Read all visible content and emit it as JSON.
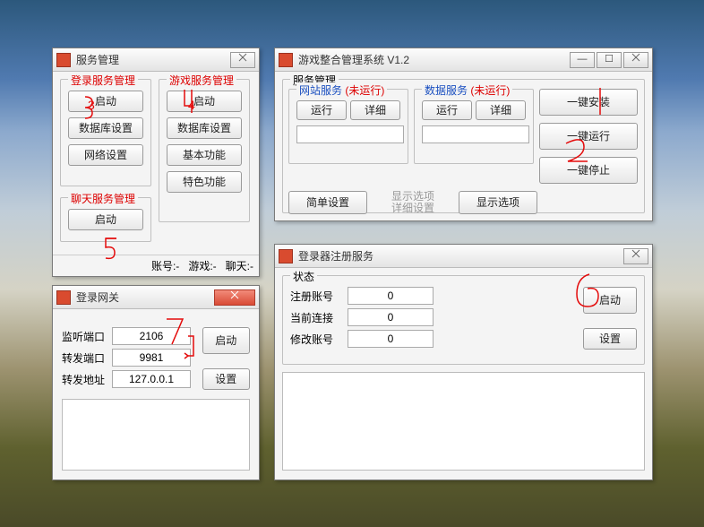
{
  "w1": {
    "title": "服务管理",
    "login_group": "登录服务管理",
    "login_start": "启动",
    "login_db": "数据库设置",
    "login_net": "网络设置",
    "game_group": "游戏服务管理",
    "game_start": "启动",
    "game_db": "数据库设置",
    "game_basic": "基本功能",
    "game_special": "特色功能",
    "chat_group": "聊天服务管理",
    "chat_start": "启动",
    "status_acct": "账号:-",
    "status_game": "游戏:-",
    "status_chat": "聊天:-"
  },
  "w2": {
    "title": "游戏整合管理系统 V1.2",
    "svc_group": "服务管理",
    "web_group": "网站服务",
    "web_state": "(未运行)",
    "data_group": "数据服务",
    "data_state": "(未运行)",
    "run": "运行",
    "detail": "详细",
    "install": "一键安装",
    "runall": "一键运行",
    "stopall": "一键停止",
    "simple": "简单设置",
    "opts_label": "显示选项\n详细设置",
    "showopts": "显示选项"
  },
  "w3": {
    "title": "登录网关",
    "port_label": "监听端口",
    "port_val": "2106",
    "fwd_label": "转发端口",
    "fwd_val": "9981",
    "addr_label": "转发地址",
    "addr_val": "127.0.0.1",
    "start": "启动",
    "settings": "设置"
  },
  "w4": {
    "title": "登录器注册服务",
    "status_group": "状态",
    "reg_label": "注册账号",
    "reg_val": "0",
    "conn_label": "当前连接",
    "conn_val": "0",
    "mod_label": "修改账号",
    "mod_val": "0",
    "start": "启动",
    "settings": "设置"
  }
}
